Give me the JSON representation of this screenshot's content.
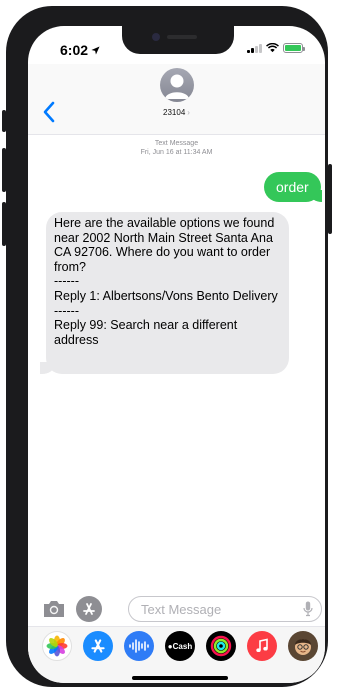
{
  "status": {
    "time": "6:02",
    "battery_color": "#34c759"
  },
  "header": {
    "contact": "23104"
  },
  "conversation": {
    "meta_type": "Text Message",
    "meta_date": "Fri, Jun 16 at 11:34 AM",
    "outgoing": "order",
    "incoming_lines": [
      "Here are the available options we found near 2002 North Main Street Santa Ana CA 92706. Where do you want to order from?",
      "------",
      "Reply 1: Albertsons/Vons Bento Delivery",
      "------",
      "Reply 99: Search near a different address"
    ]
  },
  "input": {
    "placeholder": "Text Message"
  },
  "apps": [
    {
      "name": "photos-app-icon"
    },
    {
      "name": "app-store-app-icon"
    },
    {
      "name": "audio-message-app-icon"
    },
    {
      "name": "apple-cash-app-icon",
      "label": "Cash"
    },
    {
      "name": "fitness-app-icon"
    },
    {
      "name": "music-app-icon"
    },
    {
      "name": "memoji-app-icon"
    }
  ],
  "colors": {
    "imessage_green": "#34c759",
    "ios_blue": "#007aff",
    "incoming_bubble": "#e9e9eb"
  }
}
